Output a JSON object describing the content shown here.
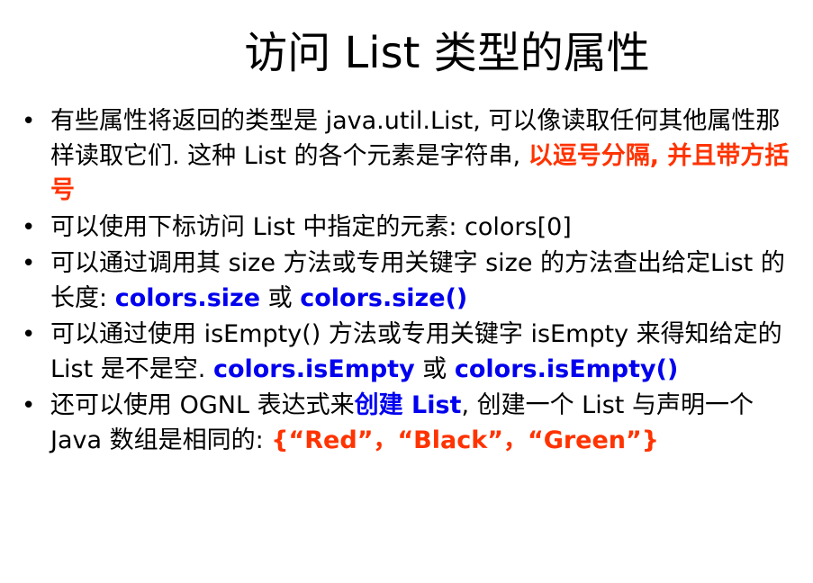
{
  "title": "访问 List 类型的属性",
  "bullet_glyph": "•",
  "bullets": [
    {
      "parts": [
        {
          "text": "有些属性将返回的类型是 java.util.List, 可以像读取任何其他属性那样读取它们. 这种 List 的各个元素是字符串, ",
          "style": "plain"
        },
        {
          "text": "以逗号分隔, 并且带方括号",
          "style": "red"
        }
      ]
    },
    {
      "parts": [
        {
          "text": "可以使用下标访问 List 中指定的元素: colors[0]",
          "style": "plain"
        }
      ]
    },
    {
      "parts": [
        {
          "text": "可以通过调用其 size 方法或专用关键字 size 的方法查出给定List 的长度: ",
          "style": "plain"
        },
        {
          "text": "colors.size",
          "style": "blue"
        },
        {
          "text": " 或 ",
          "style": "plain"
        },
        {
          "text": "colors.size()",
          "style": "blue"
        }
      ]
    },
    {
      "parts": [
        {
          "text": "可以通过使用 isEmpty() 方法或专用关键字 isEmpty 来得知给定的 List 是不是空. ",
          "style": "plain"
        },
        {
          "text": "colors.isEmpty",
          "style": "blue"
        },
        {
          "text": " 或 ",
          "style": "plain"
        },
        {
          "text": "colors.isEmpty()",
          "style": "blue"
        }
      ]
    },
    {
      "parts": [
        {
          "text": "还可以使用 OGNL 表达式来",
          "style": "plain"
        },
        {
          "text": "创建 List",
          "style": "blue"
        },
        {
          "text": ", 创建一个 List 与声明一个 Java 数组是相同的: ",
          "style": "plain"
        },
        {
          "text": "{“Red”，“Black”，“Green”}",
          "style": "red"
        }
      ]
    }
  ],
  "colors": {
    "red": "#ff3300",
    "blue": "#0000ee",
    "text": "#000000",
    "background": "#ffffff"
  }
}
